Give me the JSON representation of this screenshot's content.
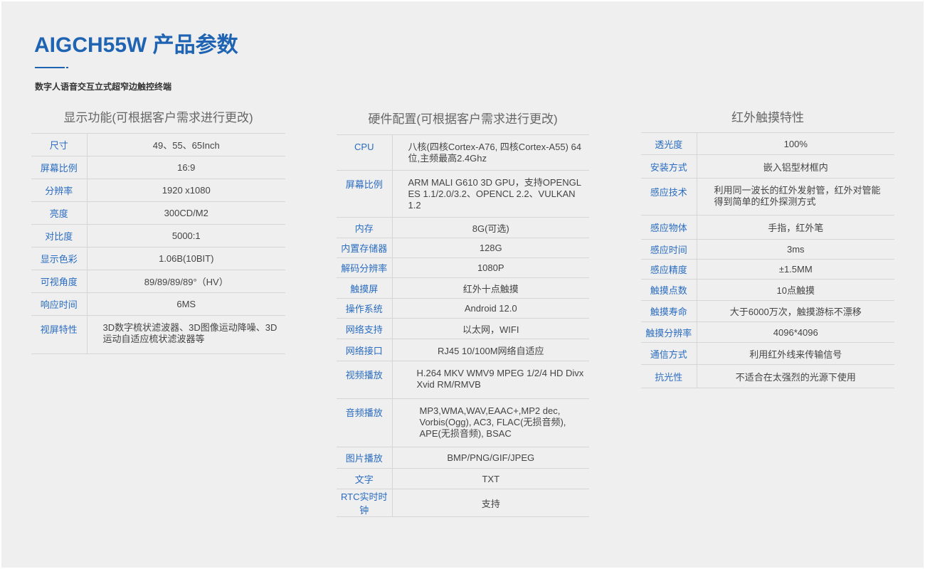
{
  "header": {
    "title": "AIGCH55W 产品参数",
    "subtitle": "数字人语音交互立式超窄边触控终端"
  },
  "columns": [
    {
      "title": "显示功能(可根据客户需求进行更改)",
      "rows": [
        {
          "k": "尺寸",
          "v": "49、55、65Inch"
        },
        {
          "k": "屏幕比例",
          "v": "16:9"
        },
        {
          "k": "分辨率",
          "v": "1920 x1080"
        },
        {
          "k": "亮度",
          "v": "300CD/M2"
        },
        {
          "k": "对比度",
          "v": "5000:1"
        },
        {
          "k": "显示色彩",
          "v": "1.06B(10BIT)"
        },
        {
          "k": "可视角度",
          "v": "89/89/89/89°（HV）"
        },
        {
          "k": "响应时间",
          "v": "6MS"
        },
        {
          "k": "视屏特性",
          "v": "3D数字梳状滤波器、3D图像运动降噪、3D运动自适应梳状滤波器等"
        }
      ]
    },
    {
      "title": "硬件配置(可根据客户需求进行更改)",
      "rows": [
        {
          "k": "CPU",
          "v": "八核(四核Cortex-A76,  四核Cortex-A55) 64位,主频最高2.4Ghz"
        },
        {
          "k": "屏幕比例",
          "v": "ARM MALI G610 3D GPU，支持OPENGL ES 1.1/2.0/3.2、OPENCL 2.2、VULKAN 1.2"
        },
        {
          "k": "内存",
          "v": "8G(可选)"
        },
        {
          "k": "内置存储器",
          "v": "128G"
        },
        {
          "k": "解码分辨率",
          "v": "1080P"
        },
        {
          "k": "触摸屏",
          "v": "红外十点触摸"
        },
        {
          "k": "操作系统",
          "v": "Android 12.0"
        },
        {
          "k": "网络支持",
          "v": "以太网，WIFI"
        },
        {
          "k": "网络接口",
          "v": "RJ45 10/100M网络自适应"
        },
        {
          "k": "视频播放",
          "v": "H.264 MKV  WMV9 MPEG 1/2/4  HD Divx Xvid RM/RMVB"
        },
        {
          "k": "音频播放",
          "v": "MP3,WMA,WAV,EAAC+,MP2 dec, Vorbis(Ogg), AC3, FLAC(无损音频), APE(无损音频), BSAC"
        },
        {
          "k": "图片播放",
          "v": "BMP/PNG/GIF/JPEG"
        },
        {
          "k": "文字",
          "v": "TXT"
        },
        {
          "k": "RTC实时时钟",
          "v": "支持"
        }
      ]
    },
    {
      "title": "红外触摸特性",
      "rows": [
        {
          "k": "透光度",
          "v": "100%"
        },
        {
          "k": "安装方式",
          "v": "嵌入铝型材框内"
        },
        {
          "k": "感应技术",
          "v": "利用同一波长的红外发射管，红外对管能得到简单的红外探测方式"
        },
        {
          "k": "感应物体",
          "v": "手指，红外笔"
        },
        {
          "k": "感应时间",
          "v": "3ms"
        },
        {
          "k": "感应精度",
          "v": "±1.5MM"
        },
        {
          "k": "触摸点数",
          "v": "10点触摸"
        },
        {
          "k": "触摸寿命",
          "v": "大于6000万次，触摸游标不漂移"
        },
        {
          "k": "触摸分辨率",
          "v": "4096*4096"
        },
        {
          "k": "通信方式",
          "v": "利用红外线来传输信号"
        },
        {
          "k": "抗光性",
          "v": "不适合在太强烈的光源下使用"
        }
      ]
    }
  ]
}
